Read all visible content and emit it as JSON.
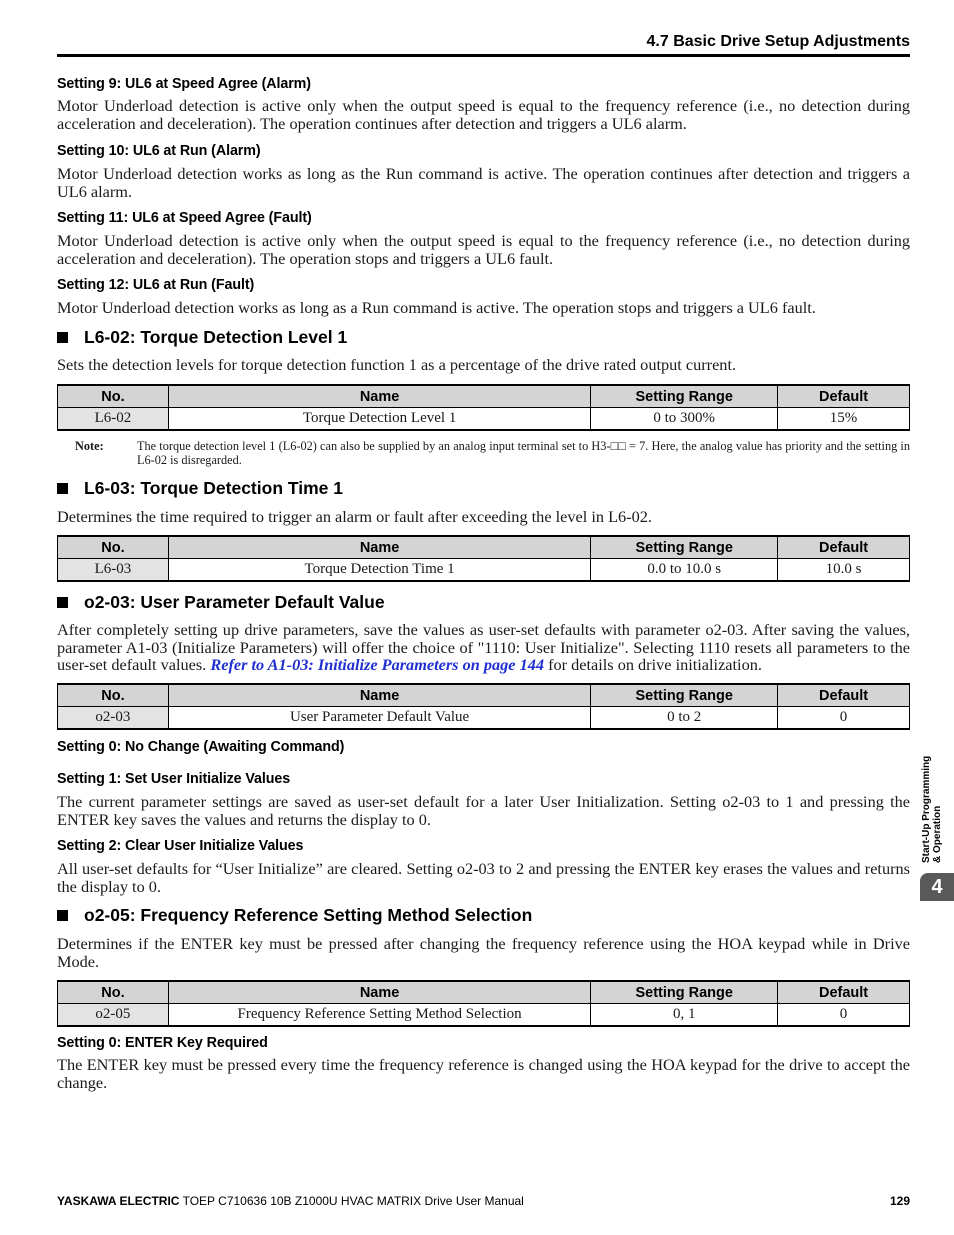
{
  "header": {
    "section_title": "4.7 Basic Drive Setup Adjustments"
  },
  "blocks": {
    "s9": {
      "title": "Setting 9: UL6 at Speed Agree (Alarm)",
      "body": "Motor Underload detection is active only when the output speed is equal to the frequency reference (i.e., no detection during acceleration and deceleration). The operation continues after detection and triggers a UL6 alarm."
    },
    "s10": {
      "title": "Setting 10: UL6 at Run (Alarm)",
      "body": "Motor Underload detection works as long as the Run command is active. The operation continues after detection and triggers a UL6 alarm."
    },
    "s11": {
      "title": "Setting 11: UL6 at Speed Agree (Fault)",
      "body": "Motor Underload detection is active only when the output speed is equal to the frequency reference (i.e., no detection during acceleration and deceleration). The operation stops and triggers a UL6 fault."
    },
    "s12": {
      "title": "Setting 12: UL6 at Run (Fault)",
      "body": "Motor Underload detection works as long as a Run command is active. The operation stops and triggers a UL6 fault."
    }
  },
  "table_headers": {
    "no": "No.",
    "name": "Name",
    "range": "Setting Range",
    "default": "Default"
  },
  "l602": {
    "heading": "L6-02: Torque Detection Level 1",
    "description": "Sets the detection levels for torque detection function 1 as a percentage of the drive rated output current.",
    "row": {
      "no": "L6-02",
      "name": "Torque Detection Level 1",
      "range": "0 to 300%",
      "default": "15%"
    },
    "note_label": "Note:",
    "note_text": "The torque detection level 1 (L6-02) can also be supplied by an analog input terminal set to H3-□□ = 7. Here, the analog value has priority and the setting in L6-02 is disregarded."
  },
  "l603": {
    "heading": "L6-03: Torque Detection Time 1",
    "description": "Determines the time required to trigger an alarm or fault after exceeding the level in L6-02.",
    "row": {
      "no": "L6-03",
      "name": "Torque Detection Time 1",
      "range": "0.0 to 10.0 s",
      "default": "10.0 s"
    }
  },
  "o203": {
    "heading": "o2-03: User Parameter Default Value",
    "description_pre": "After completely setting up drive parameters, save the values as user-set defaults with parameter o2-03. After saving the values, parameter A1-03 (Initialize Parameters) will offer the choice of \"1110: User Initialize\". Selecting 1110 resets all parameters to the user-set default values. ",
    "link_text": "Refer to A1-03: Initialize Parameters on page 144",
    "description_post": " for details on drive initialization.",
    "row": {
      "no": "o2-03",
      "name": "User Parameter Default Value",
      "range": "0 to 2",
      "default": "0"
    },
    "settings": [
      {
        "title": "Setting 0: No Change (Awaiting Command)",
        "body": ""
      },
      {
        "title": "Setting 1: Set User Initialize Values",
        "body": "The current parameter settings are saved as user-set default for a later User Initialization. Setting o2-03 to 1 and pressing the ENTER key saves the values and returns the display to 0."
      },
      {
        "title": "Setting 2: Clear User Initialize Values",
        "body": "All user-set defaults for “User Initialize” are cleared. Setting o2-03 to 2 and pressing the ENTER key erases the values and returns the display to 0."
      }
    ]
  },
  "o205": {
    "heading": "o2-05: Frequency Reference Setting Method Selection",
    "description": "Determines if the ENTER key must be pressed after changing the frequency reference using the HOA keypad while in Drive Mode.",
    "row": {
      "no": "o2-05",
      "name": "Frequency Reference Setting Method Selection",
      "range": "0, 1",
      "default": "0"
    },
    "settings": [
      {
        "title": "Setting 0: ENTER Key Required",
        "body": "The ENTER key must be pressed every time the frequency reference is changed using the HOA keypad for the drive to accept the change."
      }
    ]
  },
  "side_tab": {
    "line1": "Start-Up Programming",
    "line2": "& Operation",
    "chapter": "4"
  },
  "footer": {
    "brand": "YASKAWA ELECTRIC",
    "doc": "TOEP C710636 10B Z1000U HVAC MATRIX Drive User Manual",
    "page": "129"
  }
}
